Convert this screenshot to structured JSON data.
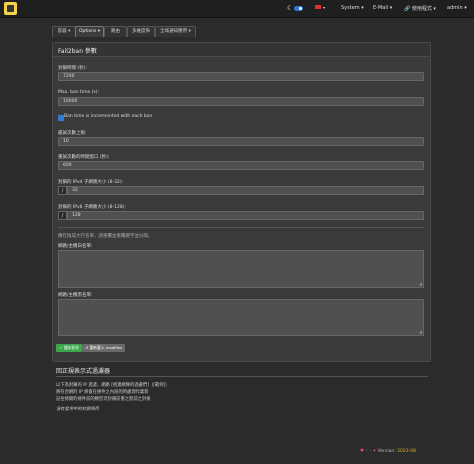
{
  "navbar": {
    "system": "System",
    "email": "E-Mail",
    "user_settings": "使用程式",
    "user": "admin"
  },
  "tabs": [
    {
      "label": "容器"
    },
    {
      "label": "Options"
    },
    {
      "label": "路由"
    },
    {
      "label": "多維度佈"
    },
    {
      "label": "全域通知應用"
    }
  ],
  "panel": {
    "title": "Fail2ban 參數",
    "fields": [
      {
        "label": "封鎖時間 (秒):",
        "value": "7200"
      },
      {
        "label": "Max. ban time (s):",
        "value": "10000"
      }
    ],
    "checkbox_label": "Ban time is incremented with each ban",
    "fields2": [
      {
        "label": "最試次數上限:",
        "value": "10"
      },
      {
        "label": "重試次數的時間窗口 (秒):",
        "value": "600"
      }
    ],
    "ipv4": {
      "label": "封鎖的 IPv4 子網路大小 (8-32):",
      "prefix": "/",
      "value": "32"
    },
    "ipv6": {
      "label": "封鎖的 IPv6 子網路大小 (8-128):",
      "prefix": "/",
      "value": "128"
    },
    "hint": "應在換成大行名單，請重覆並重覆鍵字並分隔。",
    "whitelist_label": "網路/主機白名單:",
    "blacklist_label": "網路/主機黑名單:",
    "save_button": "✓ 儲存更改",
    "reset_button": "↺ 重新載入 modifies"
  },
  "regex": {
    "title": "回正規表示式過濾器",
    "lines": [
      "以下為封鎖的 IP 過濾，網路 [相連網隊的過慮們]（[範例]）",
      "將符合網的 IP 將會在條件之內短的時處理作業新",
      "記住修鍵的條件前的類型可封鎖前重之而前之封後"
    ],
    "empty": "沒有套用中的封鎖項目"
  },
  "footer": {
    "version_label": "Version:",
    "version": "2023-08"
  }
}
